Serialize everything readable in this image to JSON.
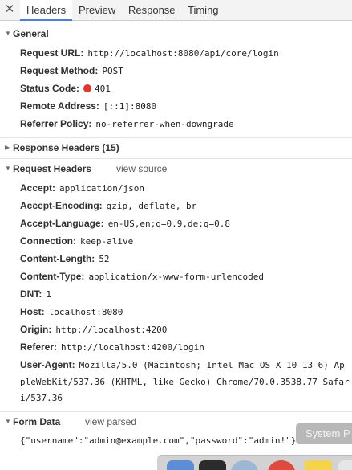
{
  "tabs": [
    {
      "label": "Headers",
      "active": true
    },
    {
      "label": "Preview",
      "active": false
    },
    {
      "label": "Response",
      "active": false
    },
    {
      "label": "Timing",
      "active": false
    }
  ],
  "close_icon": "close-icon",
  "general": {
    "title": "General",
    "request_url": {
      "key": "Request URL:",
      "value": "http://localhost:8080/api/core/login"
    },
    "request_method": {
      "key": "Request Method:",
      "value": "POST"
    },
    "status_code": {
      "key": "Status Code:",
      "value": "401",
      "dot_color": "#e8332a"
    },
    "remote_address": {
      "key": "Remote Address:",
      "value": "[::1]:8080"
    },
    "referrer_policy": {
      "key": "Referrer Policy:",
      "value": "no-referrer-when-downgrade"
    }
  },
  "response_headers": {
    "title": "Response Headers (15)"
  },
  "request_headers": {
    "title": "Request Headers",
    "aux": "view source",
    "items": [
      {
        "key": "Accept:",
        "value": "application/json"
      },
      {
        "key": "Accept-Encoding:",
        "value": "gzip, deflate, br"
      },
      {
        "key": "Accept-Language:",
        "value": "en-US,en;q=0.9,de;q=0.8"
      },
      {
        "key": "Connection:",
        "value": "keep-alive"
      },
      {
        "key": "Content-Length:",
        "value": "52"
      },
      {
        "key": "Content-Type:",
        "value": "application/x-www-form-urlencoded"
      },
      {
        "key": "DNT:",
        "value": "1"
      },
      {
        "key": "Host:",
        "value": "localhost:8080"
      },
      {
        "key": "Origin:",
        "value": "http://localhost:4200"
      },
      {
        "key": "Referer:",
        "value": "http://localhost:4200/login"
      }
    ],
    "user_agent": {
      "key": "User-Agent:",
      "line1": "Mozilla/5.0 (Macintosh; Intel Mac OS X 10_13_6) Ap",
      "line2": "pleWebKit/537.36 (KHTML, like Gecko) Chrome/70.0.3538.77 Safar",
      "line3": "i/537.36"
    }
  },
  "form_data": {
    "title": "Form Data",
    "aux": "view parsed",
    "value": "{\"username\":\"admin@example.com\",\"password\":\"admin!\"}"
  },
  "system_button": {
    "label": "System P"
  },
  "colors": {
    "accent": "#4a7ee0",
    "status_error": "#e8332a"
  },
  "dock": {
    "icons": [
      {
        "name": "finder-icon",
        "color": "#5a8fd8"
      },
      {
        "name": "terminal-icon",
        "color": "#2b2b2b"
      },
      {
        "name": "safari-icon",
        "color": "#9ab8d4"
      },
      {
        "name": "chrome-icon",
        "color": "#e04a3c"
      },
      {
        "name": "notes-icon",
        "color": "#f5d44a"
      },
      {
        "name": "app-icon",
        "color": "#e6e6e6"
      }
    ]
  }
}
